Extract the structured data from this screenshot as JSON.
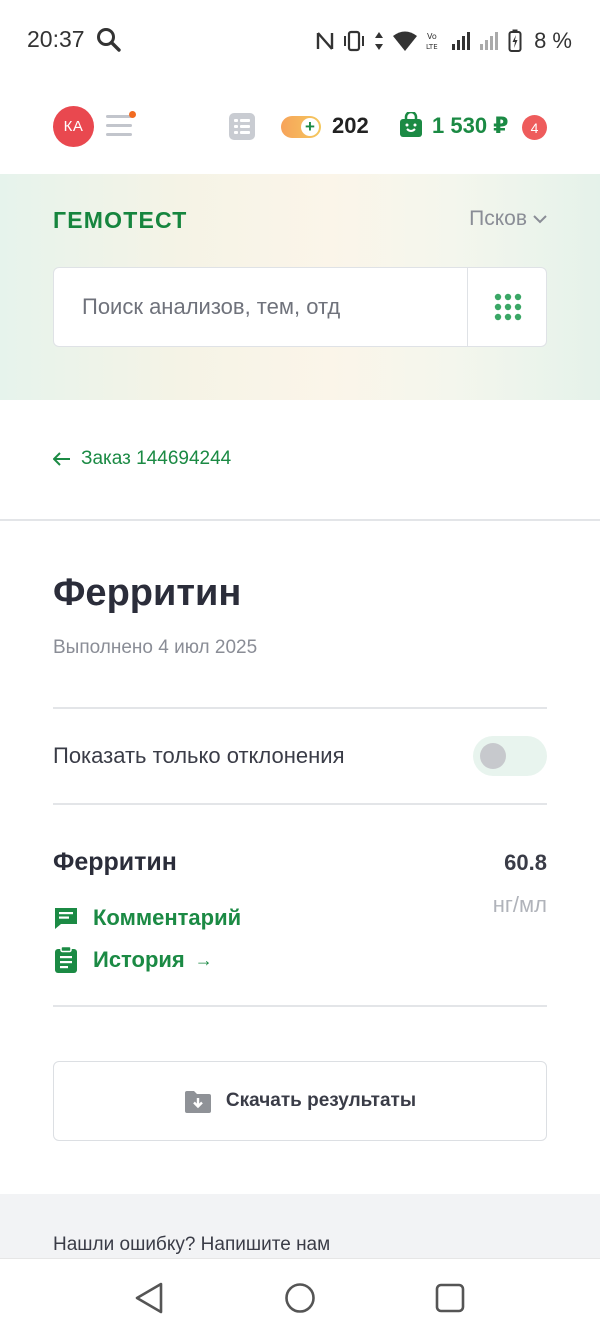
{
  "status_bar": {
    "time": "20:37",
    "battery": "8 %"
  },
  "header": {
    "avatar_initials": "КА",
    "bonus_points": "202",
    "cart_sum": "1 530 ₽",
    "cart_count": "4"
  },
  "hero": {
    "logo": "ГЕМОТЕСТ",
    "city": "Псков",
    "search_placeholder": "Поиск анализов, тем, отд"
  },
  "nav": {
    "back_label": "Заказ 144694244"
  },
  "result": {
    "title": "Ферритин",
    "completed": "Выполнено 4 июл 2025",
    "filter_label": "Показать только отклонения",
    "filter_on": false,
    "item": {
      "name": "Ферритин",
      "value": "60.8",
      "unit": "нг/мл",
      "comment_label": "Комментарий",
      "history_label": "История",
      "history_arrow": "→"
    },
    "download_label": "Скачать результаты"
  },
  "footer": {
    "text": "Нашли ошибку? Напишите нам"
  },
  "colors": {
    "brand_green": "#1b8a44",
    "avatar_red": "#e9484f",
    "badge_red": "#ee5c5c"
  }
}
